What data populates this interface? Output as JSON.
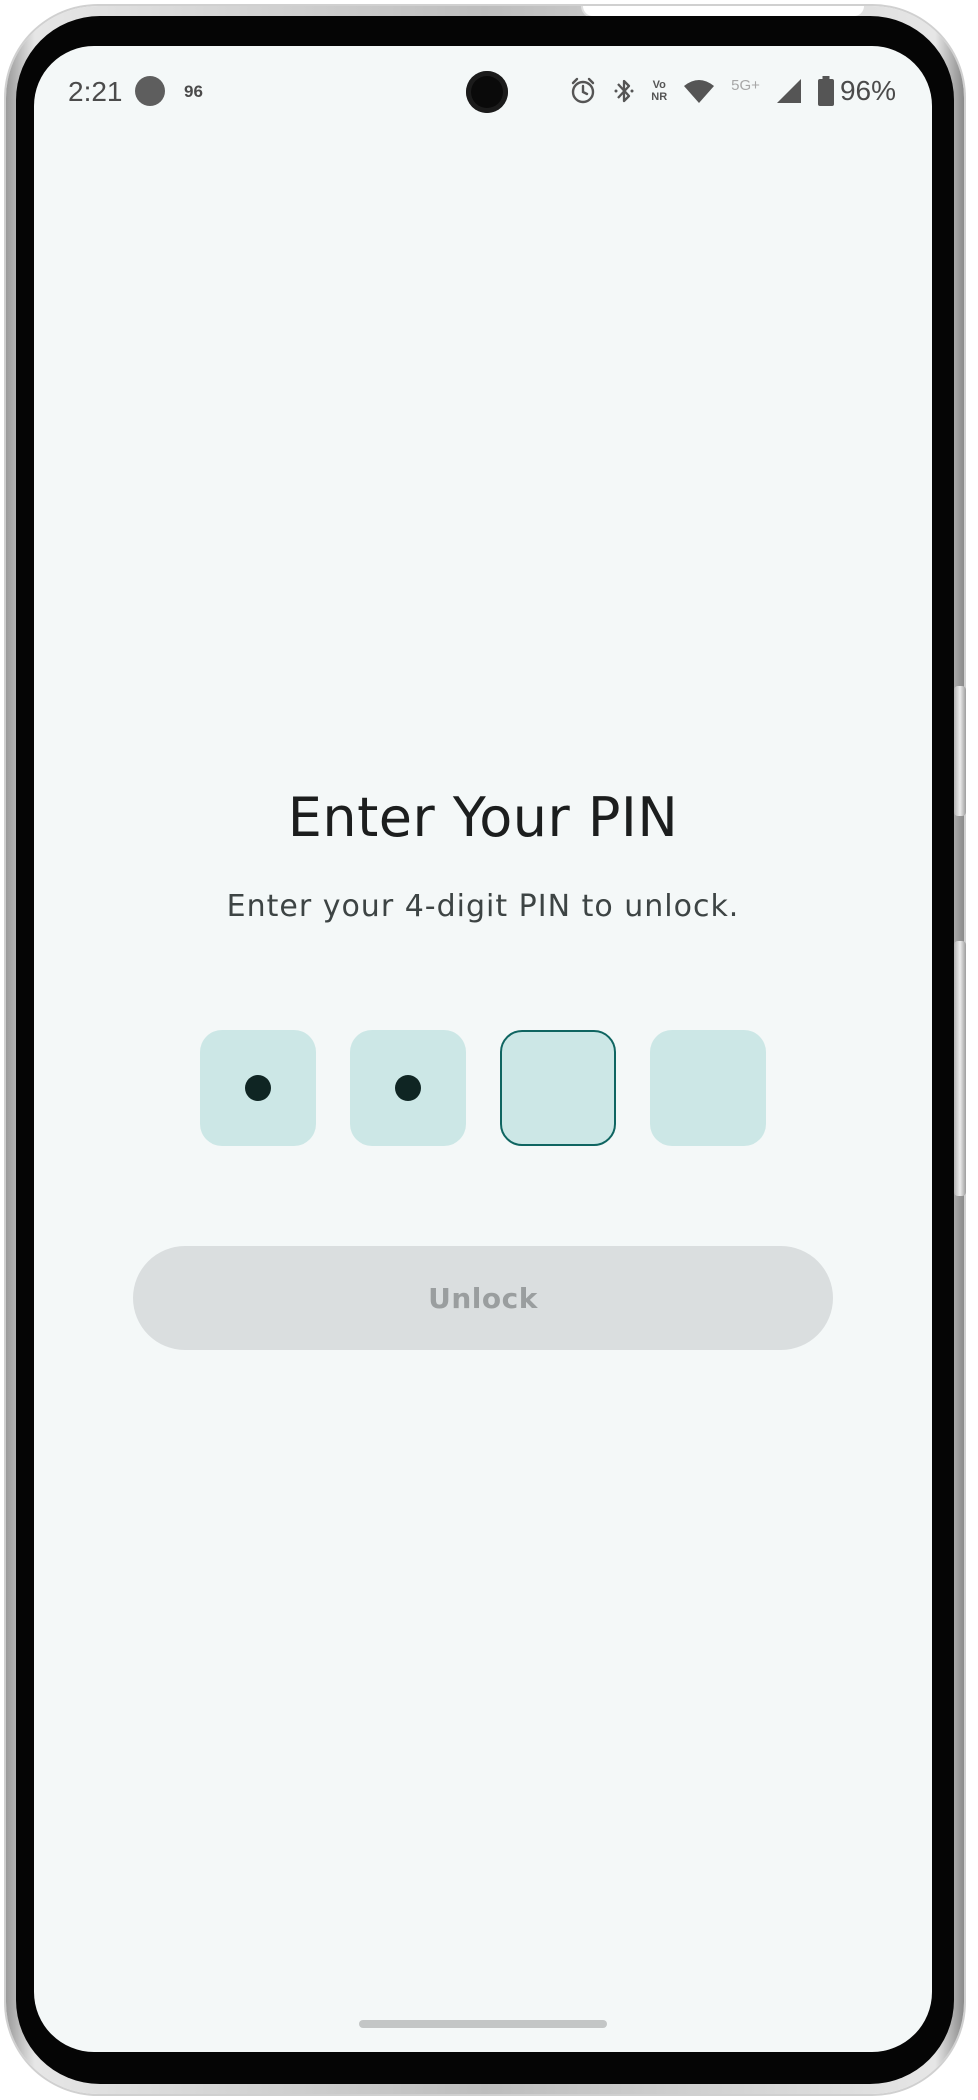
{
  "status_bar": {
    "time": "2:21",
    "notification_count": "96",
    "network_labels": {
      "volte_top": "Vo",
      "volte_bottom": "NR",
      "network_type": "5G+"
    },
    "battery_percent": "96%"
  },
  "pin_screen": {
    "title": "Enter Your PIN",
    "subtitle": "Enter your 4-digit PIN to unlock.",
    "pin_length": 4,
    "digits_entered": 2,
    "active_box_index": 2,
    "unlock_label": "Unlock",
    "unlock_enabled": false
  },
  "colors": {
    "screen_background": "#f4f8f8",
    "pin_box_fill": "#cce7e6",
    "pin_box_active_border": "#0f6561",
    "pin_dot": "#0f2523",
    "button_disabled_fill": "#dadedf",
    "button_disabled_text": "#9a9e9f"
  },
  "icons": [
    "alarm-icon",
    "bluetooth-icon",
    "volte-icon",
    "wifi-icon",
    "signal-icon",
    "battery-icon"
  ]
}
